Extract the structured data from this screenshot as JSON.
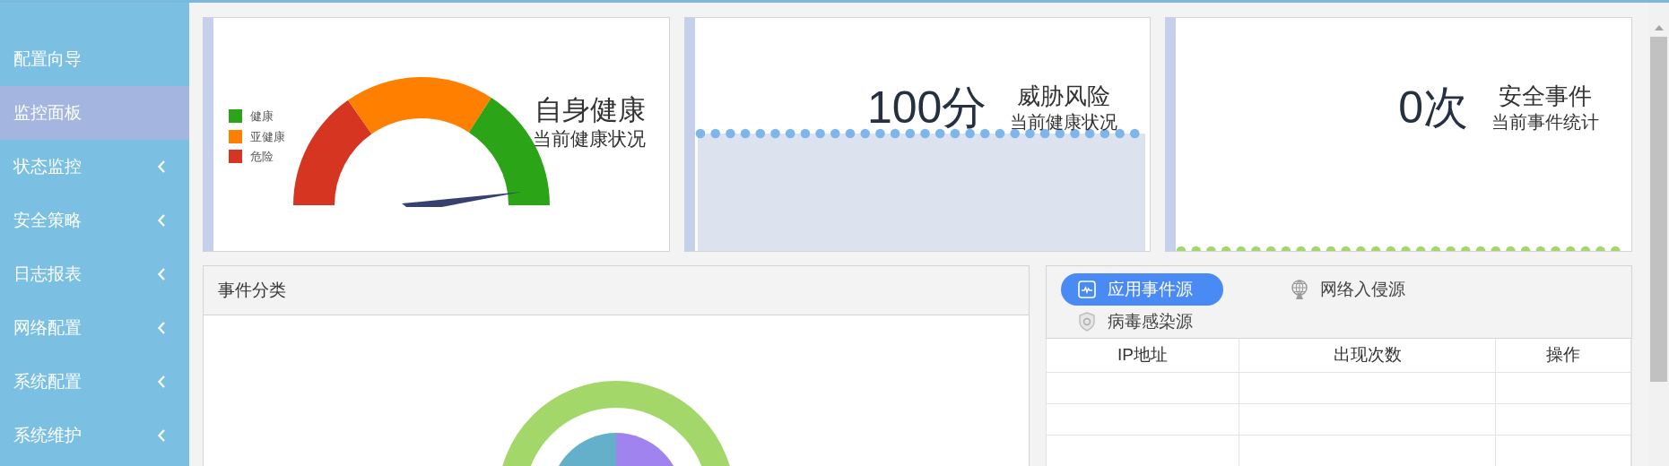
{
  "sidebar": {
    "items": [
      {
        "label": "配置向导",
        "selected": false,
        "expandable": false
      },
      {
        "label": "监控面板",
        "selected": true,
        "expandable": false
      },
      {
        "label": "状态监控",
        "selected": false,
        "expandable": true
      },
      {
        "label": "安全策略",
        "selected": false,
        "expandable": true
      },
      {
        "label": "日志报表",
        "selected": false,
        "expandable": true
      },
      {
        "label": "网络配置",
        "selected": false,
        "expandable": true
      },
      {
        "label": "系统配置",
        "selected": false,
        "expandable": true
      },
      {
        "label": "系统维护",
        "selected": false,
        "expandable": true
      }
    ]
  },
  "cards": [
    {
      "kind": "gauge",
      "title": "自身健康",
      "subtitle": "当前健康状况",
      "legend": [
        {
          "label": "健康",
          "color": "#2ca418"
        },
        {
          "label": "亚健康",
          "color": "#ff8000"
        },
        {
          "label": "危险",
          "color": "#d63522"
        }
      ]
    },
    {
      "kind": "liquid",
      "value": "100分",
      "title": "威胁风险",
      "subtitle": "当前健康状况",
      "color": "#7eb6ea"
    },
    {
      "kind": "baseline",
      "value": "0次",
      "title": "安全事件",
      "subtitle": "当前事件统计",
      "color": "#a3d76a"
    }
  ],
  "event_panel": {
    "title": "事件分类"
  },
  "source_panel": {
    "tabs": [
      {
        "label": "应用事件源",
        "selected": true
      },
      {
        "label": "网络入侵源",
        "selected": false
      },
      {
        "label": "病毒感染源",
        "selected": false
      }
    ],
    "table": {
      "columns": [
        "IP地址",
        "出现次数",
        "操作"
      ]
    }
  }
}
